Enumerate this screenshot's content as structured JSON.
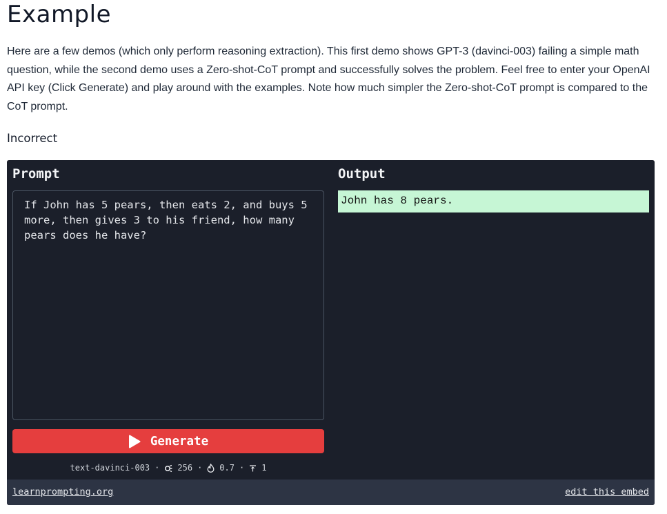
{
  "page": {
    "title": "Example",
    "intro": "Here are a few demos (which only perform reasoning extraction). This first demo shows GPT-3 (davinci-003) failing a simple math question, while the second demo uses a Zero-shot-CoT prompt and successfully solves the problem. Feel free to enter your OpenAI API key (Click Generate) and play around with the examples. Note how much simpler the Zero-shot-CoT prompt is compared to the CoT prompt.",
    "subheading": "Incorrect"
  },
  "embed": {
    "prompt_heading": "Prompt",
    "output_heading": "Output",
    "prompt_text": "If John has 5 pears, then eats 2, and buys 5 more, then gives 3 to his friend, how many pears does he have?",
    "output_text": "John has 8 pears.",
    "generate_label": "Generate",
    "meta": {
      "model": "text-davinci-003",
      "max_tokens": "256",
      "temperature": "0.7",
      "top_p": "1",
      "separator": "·"
    },
    "footer": {
      "site_link": "learnprompting.org",
      "edit_link": "edit this embed"
    }
  },
  "colors": {
    "embed_bg": "#1b1f2a",
    "footer_bg": "#2d3444",
    "generate_bg": "#e53e3e",
    "output_bg": "#c6f6d5"
  },
  "icons": {
    "generate": "play-icon",
    "max_tokens": "token-icon",
    "temperature": "flame-icon",
    "top_p": "top-p-icon"
  }
}
